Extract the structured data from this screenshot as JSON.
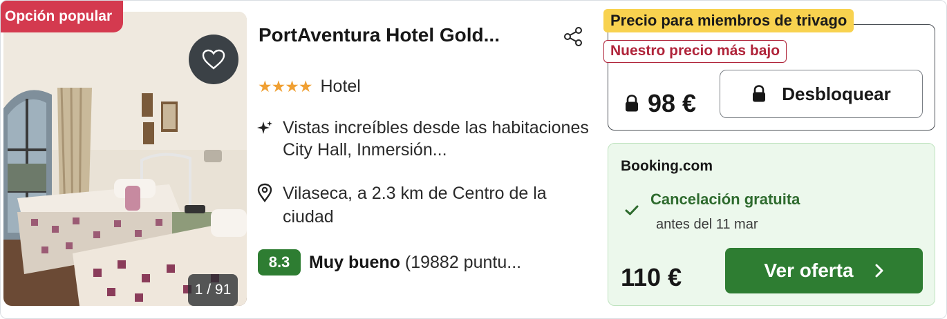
{
  "photo": {
    "badge": "Opción popular",
    "counter": "1 / 91"
  },
  "hotel": {
    "name": "PortAventura Hotel Gold...",
    "stars": "★★★★",
    "star_count": 4,
    "type": "Hotel",
    "feature": "Vistas increíbles desde las habitaciones City Hall, Inmersión...",
    "location": "Vilaseca, a 2.3 km de Centro de la ciudad",
    "rating": {
      "score": "8.3",
      "label": "Muy bueno",
      "reviews": "(19882 puntu..."
    }
  },
  "member_offer": {
    "tag": "Precio para miembros de trivago",
    "lowest_tag": "Nuestro precio más bajo",
    "price": "98 €",
    "unlock_label": "Desbloquear"
  },
  "deal": {
    "provider": "Booking.com",
    "cancellation": "Cancelación gratuita",
    "cancellation_until": "antes del 11 mar",
    "price": "110 €",
    "cta_label": "Ver oferta"
  },
  "colors": {
    "badge_red": "#d43a4f",
    "member_yellow": "#f8d24f",
    "lowest_red": "#b0243a",
    "rating_green": "#2e7d32",
    "deal_bg": "#ecf8ec",
    "star_orange": "#f0a033"
  },
  "icons": [
    "heart-icon",
    "share-icon",
    "sparkle-icon",
    "location-pin-icon",
    "lock-icon",
    "check-icon",
    "chevron-right-icon"
  ]
}
